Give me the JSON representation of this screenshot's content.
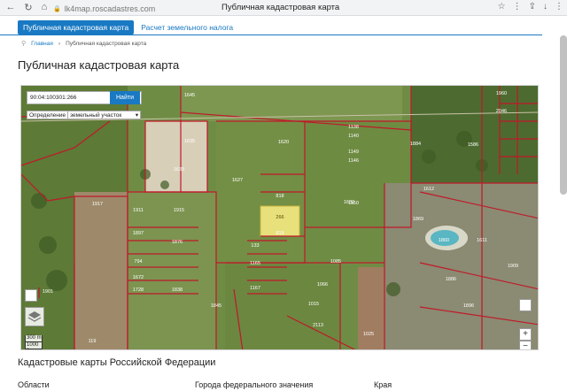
{
  "browser": {
    "url": "lk4map.roscadastres.com",
    "tab_title": "Публичная кадастровая карта"
  },
  "tabs": {
    "active": "Публичная кадастровая карта",
    "link": "Расчет земельного налога"
  },
  "breadcrumbs": {
    "home": "Главная",
    "separator": "›",
    "current": "Публичная кадастровая карта"
  },
  "page_title": "Публичная кадастровая карта",
  "map": {
    "search_value": "90:04:100301:266",
    "search_button": "Найти",
    "definition_label": "Определение",
    "definition_value": "земельный участок",
    "scale_m": "300 m",
    "scale_ft": "1000 ft",
    "zoom_in": "+",
    "zoom_out": "−",
    "parcel_labels": [
      "1645",
      "1635",
      "1633",
      "1620",
      "1627",
      "1138",
      "1140",
      "1149",
      "1146",
      "1150",
      "1884",
      "1586",
      "1960",
      "2046",
      "1612",
      "1917",
      "1911",
      "1915",
      "1901",
      "1897",
      "1876",
      "794",
      "1672",
      "1728",
      "1838",
      "1901",
      "266",
      "818",
      "819",
      "133",
      "1165",
      "1167",
      "1085",
      "1066",
      "1015",
      "2113",
      "1025",
      "1632",
      "1869",
      "1860",
      "1611",
      "1886",
      "1896",
      "1909",
      "119",
      "1845"
    ]
  },
  "section": {
    "title": "Кадастровые карты Российской Федерации",
    "col1": "Области",
    "col2": "Города федерального значения",
    "col3": "Края"
  }
}
